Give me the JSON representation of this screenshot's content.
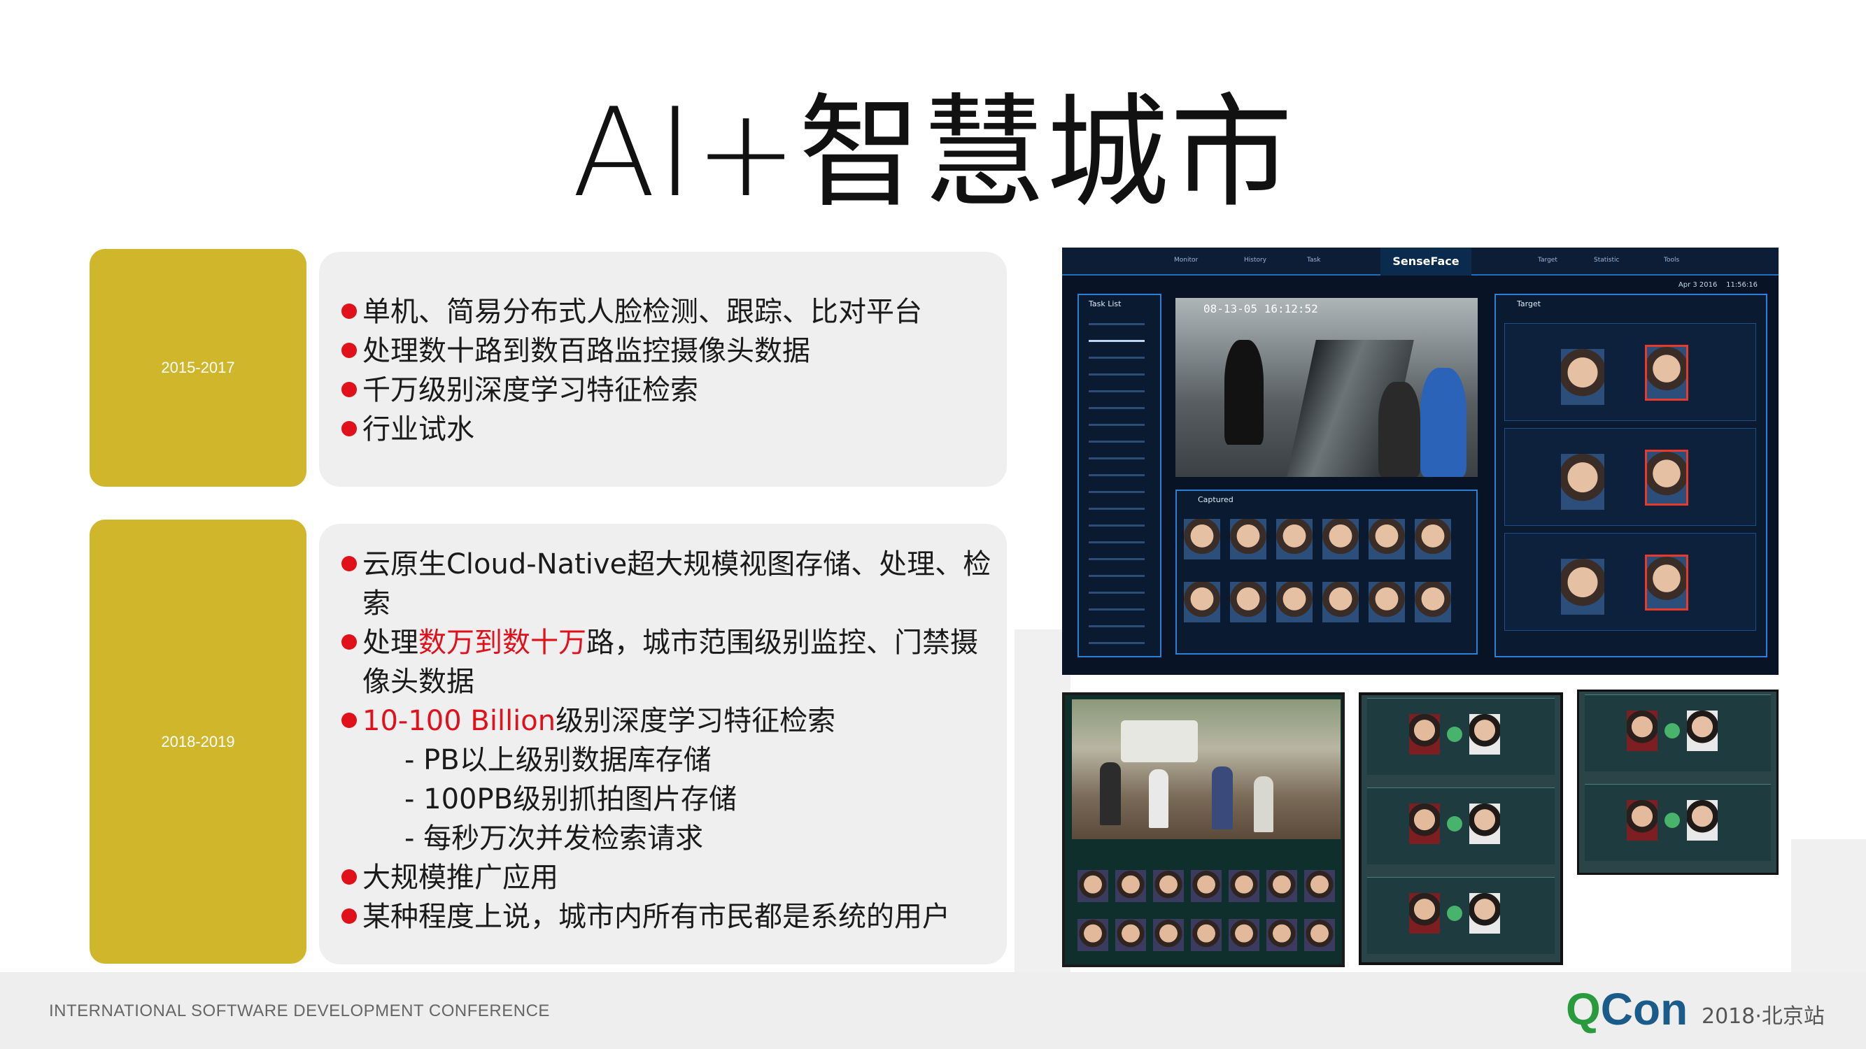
{
  "title": "AI+智慧城市",
  "periods": [
    {
      "years": "2015-2017",
      "bullets": [
        {
          "segments": [
            {
              "text": "单机、简易分布式人脸检测、跟踪、比对平台",
              "hl": false
            }
          ]
        },
        {
          "segments": [
            {
              "text": "处理数十路到数百路监控摄像头数据",
              "hl": false
            }
          ]
        },
        {
          "segments": [
            {
              "text": "千万级别深度学习特征检索",
              "hl": false
            }
          ]
        },
        {
          "segments": [
            {
              "text": "行业试水",
              "hl": false
            }
          ]
        }
      ]
    },
    {
      "years": "2018-2019",
      "lines": [
        {
          "kind": "bullet",
          "a": "云原生Cloud-Native超大规模视图存储、处理、检",
          "b": "",
          "c": ""
        },
        {
          "kind": "cont",
          "a": "索",
          "b": "",
          "c": ""
        },
        {
          "kind": "bullet",
          "a": "处理",
          "b": "数万到数十万",
          "c": "路，城市范围级别监控、门禁摄"
        },
        {
          "kind": "cont",
          "a": "像头数据",
          "b": "",
          "c": ""
        },
        {
          "kind": "bullet",
          "a": "",
          "b": "10-100 Billion",
          "c": "级别深度学习特征检索"
        },
        {
          "kind": "sub",
          "a": "- PB以上级别数据库存储",
          "b": "",
          "c": ""
        },
        {
          "kind": "sub",
          "a": "- 100PB级别抓拍图片存储",
          "b": "",
          "c": ""
        },
        {
          "kind": "sub",
          "a": "- 每秒万次并发检索请求",
          "b": "",
          "c": ""
        },
        {
          "kind": "bullet",
          "a": "大规模推广应用",
          "b": "",
          "c": ""
        },
        {
          "kind": "bullet",
          "a": "某种程度上说，城市内所有市民都是系统的用户",
          "b": "",
          "c": ""
        }
      ]
    }
  ],
  "screenshot_main": {
    "brand": "SenseFace",
    "nav_left": [
      "Monitor",
      "History",
      "Task"
    ],
    "nav_right": [
      "Target",
      "Statistic",
      "Tools"
    ],
    "date": "Apr 3 2016",
    "time": "11:56:16",
    "task_panel_title": "Task List",
    "video_timestamp": "08-13-05 16:12:52",
    "captured_title": "Captured",
    "target_title": "Target"
  },
  "footer": {
    "conference": "INTERNATIONAL SOFTWARE DEVELOPMENT CONFERENCE",
    "logo_q": "Q",
    "logo_rest": "Con",
    "edition": "2018·北京站"
  },
  "colors": {
    "year_box": "#d0b62a",
    "content_box": "#efefef",
    "bullet_red": "#e0111b",
    "logo_blue": "#1a5b8a",
    "logo_green": "#2a9b3d"
  }
}
